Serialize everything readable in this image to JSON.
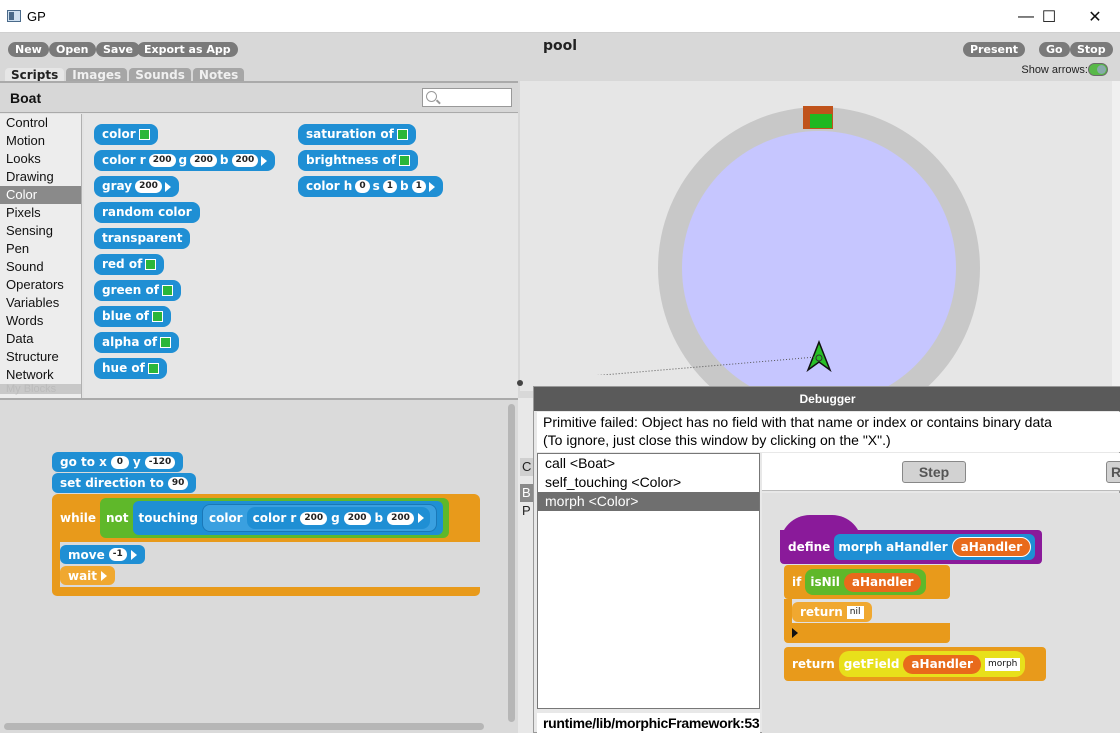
{
  "window": {
    "title": "GP",
    "minimize": "—",
    "maximize": "☐",
    "close": "✕"
  },
  "toolbar": {
    "new": "New",
    "open": "Open",
    "save": "Save",
    "export": "Export as App",
    "project_name": "pool",
    "present": "Present",
    "go": "Go",
    "stop": "Stop",
    "show_arrows": "Show arrows:"
  },
  "tabs": [
    "Scripts",
    "Images",
    "Sounds",
    "Notes"
  ],
  "sprite": {
    "name": "Boat"
  },
  "categories": [
    "Control",
    "Motion",
    "Looks",
    "Drawing",
    "Color",
    "Pixels",
    "Sensing",
    "Pen",
    "Sound",
    "Operators",
    "Variables",
    "Words",
    "Data",
    "Structure",
    "Network",
    "My Blocks"
  ],
  "palette": {
    "color": "color",
    "color_rgb": {
      "label": "color r",
      "g": "g",
      "b": "b",
      "r_val": "200",
      "g_val": "200",
      "b_val": "200"
    },
    "gray": {
      "label": "gray",
      "val": "200"
    },
    "random_color": "random color",
    "transparent": "transparent",
    "red_of": "red of",
    "green_of": "green of",
    "blue_of": "blue of",
    "alpha_of": "alpha of",
    "hue_of": "hue of",
    "saturation_of": "saturation of",
    "brightness_of": "brightness of",
    "color_hsb": {
      "label": "color h",
      "s": "s",
      "b": "b",
      "h_val": "0",
      "s_val": "1",
      "b_val": "1"
    }
  },
  "script": {
    "goto": {
      "label": "go to x",
      "x": "0",
      "ylabel": "y",
      "y": "-120"
    },
    "set_direction": {
      "label": "set direction to",
      "val": "90"
    },
    "while": "while",
    "not": "not",
    "touching": "touching",
    "color": "color",
    "color_r": "color r",
    "g": "g",
    "b": "b",
    "r_val": "200",
    "g_val": "200",
    "b_val": "200",
    "move": {
      "label": "move",
      "val": "-1"
    },
    "wait": "wait"
  },
  "debugger": {
    "title": "Debugger",
    "message_line1": "Primitive failed: Object has no field with that name or index or contains binary data",
    "message_line2": "(To ignore, just close this window by clicking on the \"X\".)",
    "frames": [
      "call <Boat>",
      "self_touching <Color>",
      "morph <Color>"
    ],
    "location": "runtime/lib/morphicFramework:53",
    "step": "Step",
    "resume_partial": "R",
    "code": {
      "define": "define",
      "morph": "morph",
      "aHandler": "aHandler",
      "if": "if",
      "isNil": "isNil",
      "return": "return",
      "nil": "nil",
      "getField": "getField",
      "field_name": "morph"
    }
  },
  "behind_debugger": {
    "c": "C",
    "b": "B",
    "p": "P"
  }
}
